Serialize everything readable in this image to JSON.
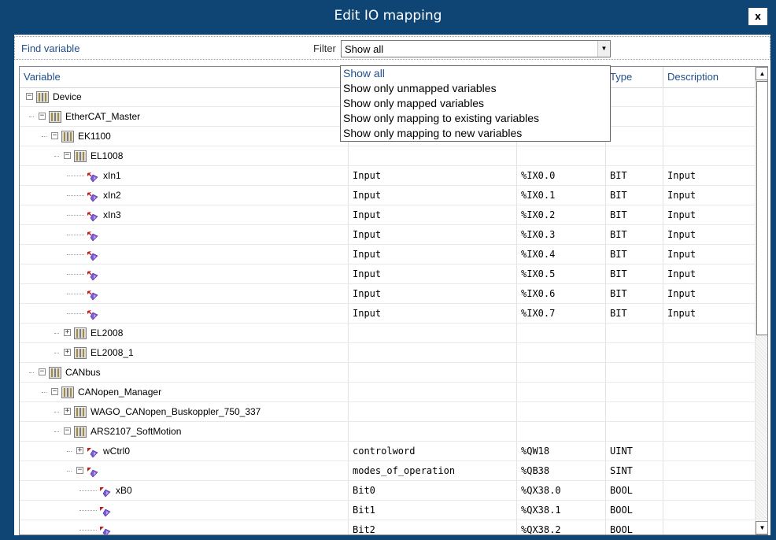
{
  "window": {
    "title": "Edit IO mapping",
    "close_label": "x"
  },
  "findbar": {
    "find_label": "Find variable",
    "filter_label": "Filter",
    "filter_value": "Show all"
  },
  "filter_options": [
    "Show all",
    "Show only unmapped variables",
    "Show only mapped variables",
    "Show only mapping to existing variables",
    "Show only mapping to new variables"
  ],
  "columns": {
    "variable": "Variable",
    "type": "Type",
    "description": "Description"
  },
  "rows": [
    {
      "name": "Device",
      "kind": "device",
      "level": 0,
      "expander": "minus",
      "mapping": "",
      "address": "",
      "type": "",
      "description": ""
    },
    {
      "name": "EtherCAT_Master",
      "kind": "device",
      "level": 1,
      "expander": "minus",
      "mapping": "",
      "address": "",
      "type": "",
      "description": ""
    },
    {
      "name": "EK1100",
      "kind": "device",
      "level": 2,
      "expander": "minus",
      "mapping": "",
      "address": "",
      "type": "",
      "description": ""
    },
    {
      "name": "EL1008",
      "kind": "device",
      "level": 3,
      "expander": "minus",
      "mapping": "",
      "address": "",
      "type": "",
      "description": ""
    },
    {
      "name": "xIn1",
      "kind": "var",
      "level": 4,
      "expander": "",
      "mapping": "Input",
      "address": "%IX0.0",
      "type": "BIT",
      "description": "Input"
    },
    {
      "name": "xIn2",
      "kind": "var",
      "level": 4,
      "expander": "",
      "mapping": "Input",
      "address": "%IX0.1",
      "type": "BIT",
      "description": "Input"
    },
    {
      "name": "xIn3",
      "kind": "var",
      "level": 4,
      "expander": "",
      "mapping": "Input",
      "address": "%IX0.2",
      "type": "BIT",
      "description": "Input"
    },
    {
      "name": "",
      "kind": "var",
      "level": 4,
      "expander": "",
      "mapping": "Input",
      "address": "%IX0.3",
      "type": "BIT",
      "description": "Input"
    },
    {
      "name": "",
      "kind": "var",
      "level": 4,
      "expander": "",
      "mapping": "Input",
      "address": "%IX0.4",
      "type": "BIT",
      "description": "Input"
    },
    {
      "name": "",
      "kind": "var",
      "level": 4,
      "expander": "",
      "mapping": "Input",
      "address": "%IX0.5",
      "type": "BIT",
      "description": "Input"
    },
    {
      "name": "",
      "kind": "var",
      "level": 4,
      "expander": "",
      "mapping": "Input",
      "address": "%IX0.6",
      "type": "BIT",
      "description": "Input"
    },
    {
      "name": "",
      "kind": "var",
      "level": 4,
      "expander": "",
      "mapping": "Input",
      "address": "%IX0.7",
      "type": "BIT",
      "description": "Input"
    },
    {
      "name": "EL2008",
      "kind": "device",
      "level": 3,
      "expander": "plus",
      "mapping": "",
      "address": "",
      "type": "",
      "description": ""
    },
    {
      "name": "EL2008_1",
      "kind": "device",
      "level": 3,
      "expander": "plus",
      "mapping": "",
      "address": "",
      "type": "",
      "description": ""
    },
    {
      "name": "CANbus",
      "kind": "device",
      "level": 1,
      "expander": "minus",
      "mapping": "",
      "address": "",
      "type": "",
      "description": ""
    },
    {
      "name": "CANopen_Manager",
      "kind": "device",
      "level": 2,
      "expander": "minus",
      "mapping": "",
      "address": "",
      "type": "",
      "description": ""
    },
    {
      "name": "WAGO_CANopen_Buskoppler_750_337",
      "kind": "device",
      "level": 3,
      "expander": "plus",
      "mapping": "",
      "address": "",
      "type": "",
      "description": ""
    },
    {
      "name": "ARS2107_SoftMotion",
      "kind": "device",
      "level": 3,
      "expander": "minus",
      "mapping": "",
      "address": "",
      "type": "",
      "description": ""
    },
    {
      "name": "wCtrl0",
      "kind": "varout",
      "level": 4,
      "expander": "plus",
      "mapping": "controlword",
      "address": "%QW18",
      "type": "UINT",
      "description": ""
    },
    {
      "name": "",
      "kind": "varout",
      "level": 4,
      "expander": "minus",
      "mapping": "modes_of_operation",
      "address": "%QB38",
      "type": "SINT",
      "description": ""
    },
    {
      "name": "xB0",
      "kind": "varout",
      "level": 5,
      "expander": "",
      "mapping": "Bit0",
      "address": "%QX38.0",
      "type": "BOOL",
      "description": ""
    },
    {
      "name": "",
      "kind": "varout",
      "level": 5,
      "expander": "",
      "mapping": "Bit1",
      "address": "%QX38.1",
      "type": "BOOL",
      "description": ""
    },
    {
      "name": "",
      "kind": "varout",
      "level": 5,
      "expander": "",
      "mapping": "Bit2",
      "address": "%QX38.2",
      "type": "BOOL",
      "description": ""
    }
  ],
  "icons": {
    "device": "device-module-icon",
    "var": "input-variable-icon",
    "varout": "output-variable-icon"
  },
  "colors": {
    "title_bar": "#0f4574",
    "header_text": "#1f4f8c"
  }
}
